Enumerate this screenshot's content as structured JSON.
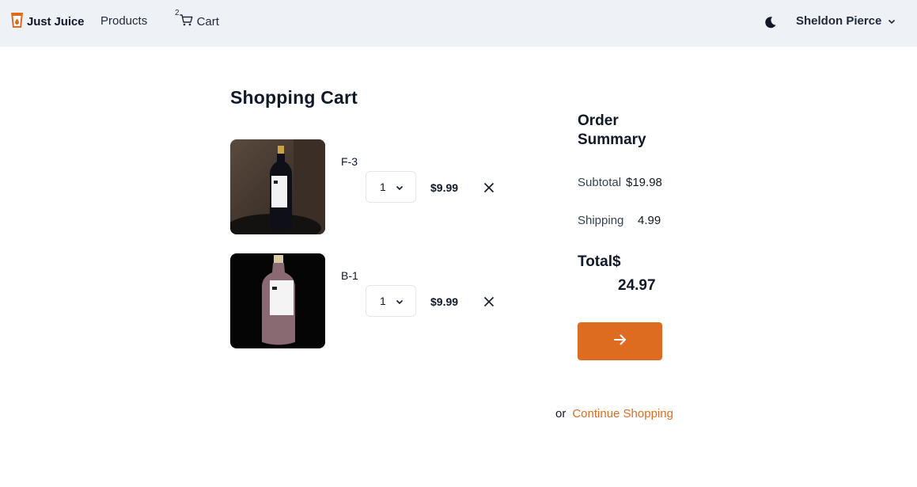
{
  "nav": {
    "brand": "Just Juice",
    "products": "Products",
    "cart_count": "2",
    "cart": "Cart",
    "user": "Sheldon Pierce"
  },
  "cart": {
    "title": "Shopping Cart",
    "items": [
      {
        "name": "F-3",
        "qty": "1",
        "price": "$9.99",
        "bottle_color": "#1a1a22"
      },
      {
        "name": "B-1",
        "qty": "1",
        "price": "$9.99",
        "bottle_color": "#8a6a72"
      }
    ]
  },
  "summary": {
    "title": "Order Summary",
    "subtotal_label": "Subtotal",
    "subtotal_value": "$19.98",
    "shipping_label": "Shipping",
    "shipping_value": "4.99",
    "total_label": "Total$",
    "total_value": "24.97"
  },
  "continue": {
    "or": "or",
    "link": "Continue Shopping"
  },
  "colors": {
    "accent": "#dd6b20",
    "navbar_bg": "#eef2f6"
  }
}
